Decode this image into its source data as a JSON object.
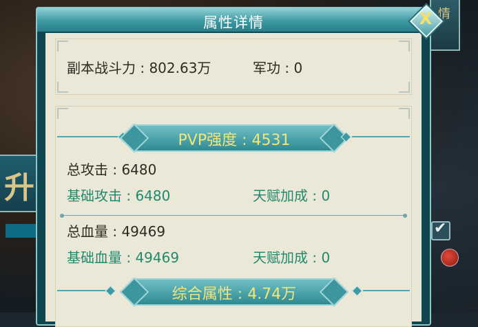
{
  "panel": {
    "title": "属性详情",
    "close_label": "X"
  },
  "summary": {
    "dungeon_power_label": "副本战斗力 : 802.63万",
    "military_merit_label": "军功 : 0"
  },
  "pvp_section": {
    "banner": "PVP强度 : 4531",
    "total_attack": "总攻击 : 6480",
    "base_attack": "基础攻击 : 6480",
    "attack_talent_bonus": "天赋加成 : 0",
    "total_hp": "总血量 : 49469",
    "base_hp": "基础血量 : 49469",
    "hp_talent_bonus": "天赋加成 : 0"
  },
  "overall_section": {
    "banner": "综合属性 : 4.74万"
  },
  "background": {
    "left_badge_char": "升",
    "right_tab_char": "情",
    "checkbox_glyph": "✔"
  },
  "colors": {
    "title_bar": "#3d9aa3",
    "banner_text": "#f2e57a",
    "dark_text": "#2f2a22",
    "green_text": "#1f8a6c",
    "panel_bg": "#e9e6d6"
  }
}
